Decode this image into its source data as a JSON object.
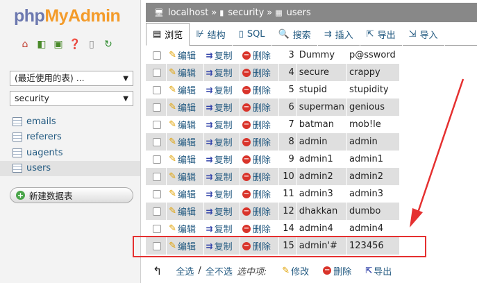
{
  "logo": {
    "php": "php",
    "myadmin": "MyAdmin"
  },
  "sidebar": {
    "recent_select": "(最近使用的表) ...",
    "db_select": "security",
    "tables": [
      "emails",
      "referers",
      "uagents",
      "users"
    ],
    "selected_table": "users",
    "new_table": "新建数据表"
  },
  "breadcrumb": {
    "server": "localhost",
    "database": "security",
    "table": "users",
    "sep": "»"
  },
  "tabs": [
    {
      "label": "浏览",
      "icon": "browse-icon"
    },
    {
      "label": "结构",
      "icon": "structure-icon"
    },
    {
      "label": "SQL",
      "icon": "sql-icon"
    },
    {
      "label": "搜索",
      "icon": "search-icon"
    },
    {
      "label": "插入",
      "icon": "insert-icon"
    },
    {
      "label": "导出",
      "icon": "export-icon"
    },
    {
      "label": "导入",
      "icon": "import-icon"
    }
  ],
  "row_actions": {
    "edit": "编辑",
    "copy": "复制",
    "delete": "删除"
  },
  "rows": [
    {
      "id": "3",
      "username": "Dummy",
      "password": "p@ssword"
    },
    {
      "id": "4",
      "username": "secure",
      "password": "crappy"
    },
    {
      "id": "5",
      "username": "stupid",
      "password": "stupidity"
    },
    {
      "id": "6",
      "username": "superman",
      "password": "genious"
    },
    {
      "id": "7",
      "username": "batman",
      "password": "mob!le"
    },
    {
      "id": "8",
      "username": "admin",
      "password": "admin"
    },
    {
      "id": "9",
      "username": "admin1",
      "password": "admin1"
    },
    {
      "id": "10",
      "username": "admin2",
      "password": "admin2"
    },
    {
      "id": "11",
      "username": "admin3",
      "password": "admin3"
    },
    {
      "id": "12",
      "username": "dhakkan",
      "password": "dumbo"
    },
    {
      "id": "14",
      "username": "admin4",
      "password": "admin4"
    },
    {
      "id": "15",
      "username": "admin'#",
      "password": "123456"
    }
  ],
  "bottom": {
    "select_all": "全选",
    "slash": "/",
    "deselect_all": "全不选",
    "with_selected": "选中项:",
    "edit": "修改",
    "delete": "删除",
    "export": "导出"
  },
  "colors": {
    "highlight": "#e53030",
    "breadcrumb_bg": "#888888",
    "link": "#235a81"
  }
}
